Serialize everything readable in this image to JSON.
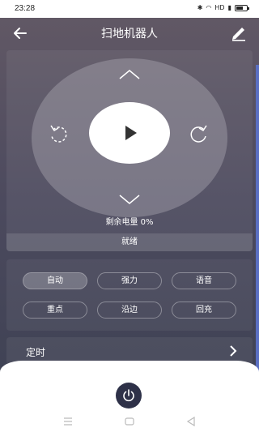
{
  "status_bar": {
    "time": "23:28",
    "network": "HD",
    "battery_percent": 60
  },
  "header": {
    "title": "扫地机器人",
    "back_icon": "arrow-left-icon",
    "edit_icon": "pencil-icon"
  },
  "control": {
    "battery_text": "剩余电量 0%",
    "status_text": "就绪",
    "icons": [
      "chevron-up-icon",
      "chevron-down-icon",
      "rotate-left-icon",
      "rotate-right-icon",
      "play-icon"
    ]
  },
  "modes": [
    {
      "label": "自动",
      "active": true
    },
    {
      "label": "强力",
      "active": false
    },
    {
      "label": "语音",
      "active": false
    },
    {
      "label": "重点",
      "active": false
    },
    {
      "label": "沿边",
      "active": false
    },
    {
      "label": "回充",
      "active": false
    }
  ],
  "timer": {
    "label": "定时"
  },
  "power": {
    "icon": "power-icon"
  },
  "colors": {
    "accent": "#2e3148",
    "right_edge": "#5a6fc2"
  }
}
